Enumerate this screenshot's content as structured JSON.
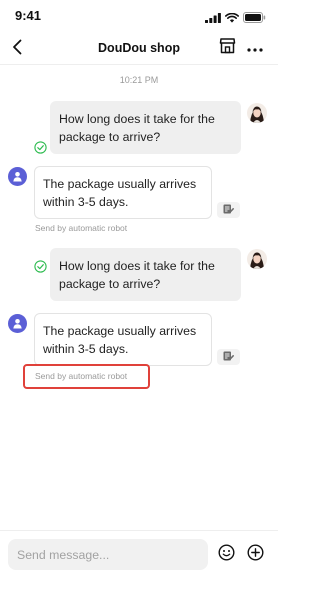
{
  "status_bar": {
    "time": "9:41",
    "icons": [
      "signal-icon",
      "wifi-icon",
      "battery-icon"
    ]
  },
  "header": {
    "title": "DouDou shop",
    "icons": [
      "back-arrow-icon",
      "store-icon",
      "more-icon"
    ]
  },
  "chat": {
    "timestamp": "10:21 PM",
    "messages": [
      {
        "sender": "user",
        "text": "How long does it take for the package to arrive?",
        "status_icon": "check-circle-icon"
      },
      {
        "sender": "robot",
        "text": "The package usually arrives within 3-5 days.",
        "note": "Send by automatic robot",
        "action_icon": "edit-feedback-icon"
      },
      {
        "sender": "user",
        "text": "How long does it take for the package to arrive?",
        "status_icon": "check-circle-icon"
      },
      {
        "sender": "robot",
        "text": "The package usually arrives within 3-5 days.",
        "note": "Send by automatic robot",
        "action_icon": "edit-feedback-icon"
      }
    ]
  },
  "composer": {
    "placeholder": "Send message...",
    "icons": [
      "emoji-icon",
      "plus-icon"
    ]
  },
  "colors": {
    "accent": "#5b5fd6",
    "check": "#2dbb4f",
    "highlight": "#e0413a",
    "outgoing_bubble": "#efefef"
  }
}
